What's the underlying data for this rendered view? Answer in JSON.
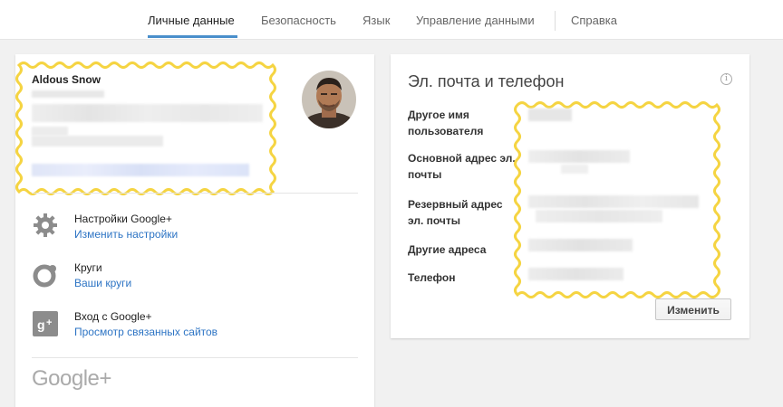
{
  "nav": {
    "tabs": [
      {
        "label": "Личные данные",
        "active": true
      },
      {
        "label": "Безопасность",
        "active": false
      },
      {
        "label": "Язык",
        "active": false
      },
      {
        "label": "Управление данными",
        "active": false
      },
      {
        "label": "Справка",
        "active": false
      }
    ]
  },
  "profile": {
    "name": "Aldous Snow"
  },
  "services": [
    {
      "title": "Настройки Google+",
      "link": "Изменить настройки",
      "icon": "gear-icon"
    },
    {
      "title": "Круги",
      "link": "Ваши круги",
      "icon": "circles-icon"
    },
    {
      "title": "Вход с Google+",
      "link": "Просмотр связанных сайтов",
      "icon": "google-plus-icon"
    }
  ],
  "brand": "Google+",
  "contact": {
    "title": "Эл. почта и телефон",
    "fields": [
      {
        "label": "Другое имя пользователя"
      },
      {
        "label": "Основной адрес эл. почты"
      },
      {
        "label": "Резервный адрес эл. почты"
      },
      {
        "label": "Другие адреса"
      },
      {
        "label": "Телефон"
      }
    ],
    "edit_button": "Изменить"
  },
  "colors": {
    "accent": "#4a8fcb",
    "link": "#2d74c4",
    "highlight": "#f5d442"
  }
}
